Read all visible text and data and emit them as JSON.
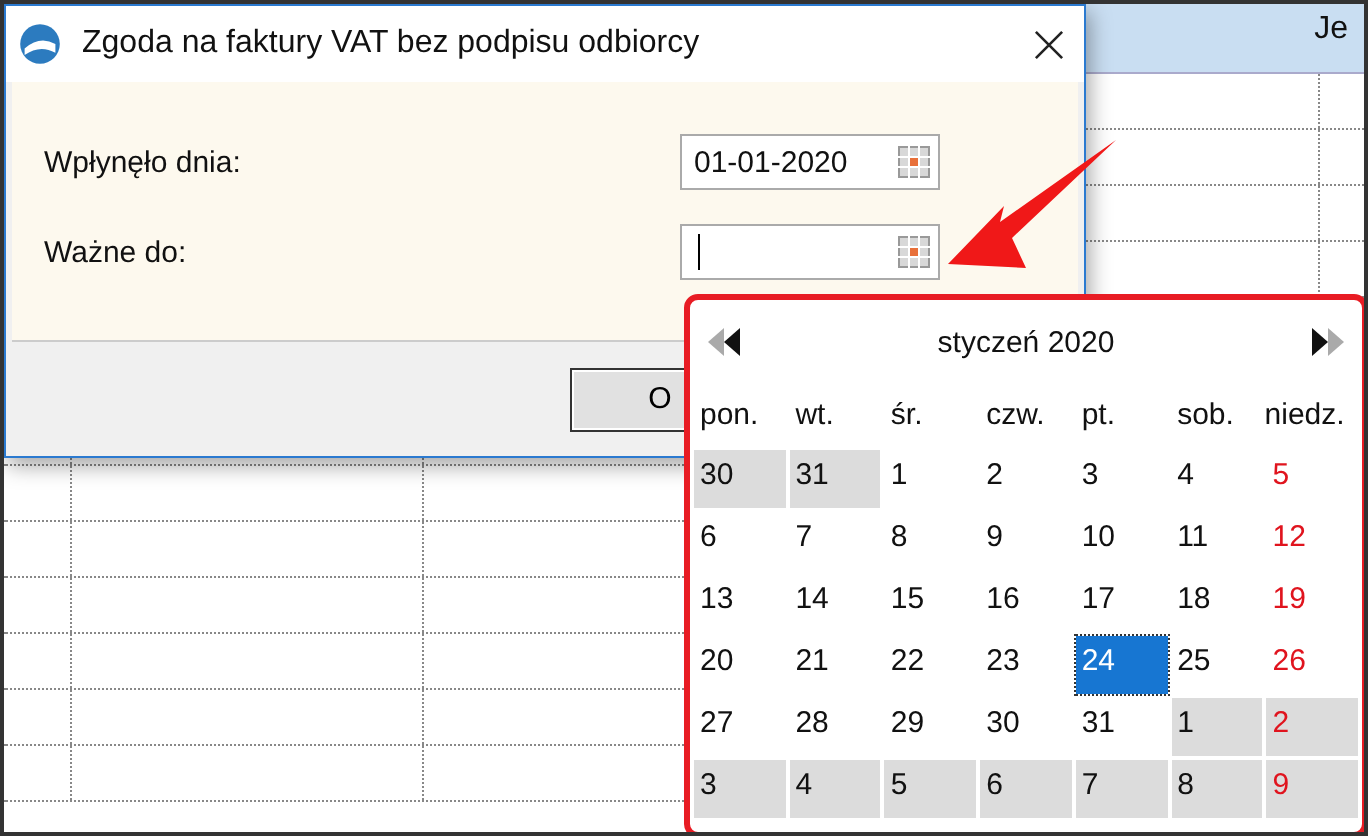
{
  "grid": {
    "header_text": "Je"
  },
  "window": {
    "title": "Zgoda na faktury VAT bez podpisu odbiorcy"
  },
  "fields": [
    {
      "label": "Wpłynęło dnia:",
      "value": "01-01-2020",
      "focused": false
    },
    {
      "label": "Ważne do:",
      "focused": true
    }
  ],
  "button": "O",
  "calendar": {
    "month": "styczeń 2020",
    "weekdays": [
      "pon.",
      "wt.",
      "śr.",
      "czw.",
      "pt.",
      "sob.",
      "niedz."
    ],
    "weeks": [
      [
        {
          "d": "30",
          "outside": true,
          "sunday": false,
          "selected": false
        },
        {
          "d": "31",
          "outside": true,
          "sunday": false,
          "selected": false
        },
        {
          "d": "1",
          "outside": false,
          "sunday": false,
          "selected": false
        },
        {
          "d": "2",
          "outside": false,
          "sunday": false,
          "selected": false
        },
        {
          "d": "3",
          "outside": false,
          "sunday": false,
          "selected": false
        },
        {
          "d": "4",
          "outside": false,
          "sunday": false,
          "selected": false
        },
        {
          "d": "5",
          "outside": false,
          "sunday": true,
          "selected": false
        }
      ],
      [
        {
          "d": "6",
          "outside": false,
          "sunday": false,
          "selected": false
        },
        {
          "d": "7",
          "outside": false,
          "sunday": false,
          "selected": false
        },
        {
          "d": "8",
          "outside": false,
          "sunday": false,
          "selected": false
        },
        {
          "d": "9",
          "outside": false,
          "sunday": false,
          "selected": false
        },
        {
          "d": "10",
          "outside": false,
          "sunday": false,
          "selected": false
        },
        {
          "d": "11",
          "outside": false,
          "sunday": false,
          "selected": false
        },
        {
          "d": "12",
          "outside": false,
          "sunday": true,
          "selected": false
        }
      ],
      [
        {
          "d": "13",
          "outside": false,
          "sunday": false,
          "selected": false
        },
        {
          "d": "14",
          "outside": false,
          "sunday": false,
          "selected": false
        },
        {
          "d": "15",
          "outside": false,
          "sunday": false,
          "selected": false
        },
        {
          "d": "16",
          "outside": false,
          "sunday": false,
          "selected": false
        },
        {
          "d": "17",
          "outside": false,
          "sunday": false,
          "selected": false
        },
        {
          "d": "18",
          "outside": false,
          "sunday": false,
          "selected": false
        },
        {
          "d": "19",
          "outside": false,
          "sunday": true,
          "selected": false
        }
      ],
      [
        {
          "d": "20",
          "outside": false,
          "sunday": false,
          "selected": false
        },
        {
          "d": "21",
          "outside": false,
          "sunday": false,
          "selected": false
        },
        {
          "d": "22",
          "outside": false,
          "sunday": false,
          "selected": false
        },
        {
          "d": "23",
          "outside": false,
          "sunday": false,
          "selected": false
        },
        {
          "d": "24",
          "outside": false,
          "sunday": false,
          "selected": true
        },
        {
          "d": "25",
          "outside": false,
          "sunday": false,
          "selected": false
        },
        {
          "d": "26",
          "outside": false,
          "sunday": true,
          "selected": false
        }
      ],
      [
        {
          "d": "27",
          "outside": false,
          "sunday": false,
          "selected": false
        },
        {
          "d": "28",
          "outside": false,
          "sunday": false,
          "selected": false
        },
        {
          "d": "29",
          "outside": false,
          "sunday": false,
          "selected": false
        },
        {
          "d": "30",
          "outside": false,
          "sunday": false,
          "selected": false
        },
        {
          "d": "31",
          "outside": false,
          "sunday": false,
          "selected": false
        },
        {
          "d": "1",
          "outside": true,
          "sunday": false,
          "selected": false
        },
        {
          "d": "2",
          "outside": true,
          "sunday": true,
          "selected": false
        }
      ],
      [
        {
          "d": "3",
          "outside": true,
          "sunday": false,
          "selected": false
        },
        {
          "d": "4",
          "outside": true,
          "sunday": false,
          "selected": false
        },
        {
          "d": "5",
          "outside": true,
          "sunday": false,
          "selected": false
        },
        {
          "d": "6",
          "outside": true,
          "sunday": false,
          "selected": false
        },
        {
          "d": "7",
          "outside": true,
          "sunday": false,
          "selected": false
        },
        {
          "d": "8",
          "outside": true,
          "sunday": false,
          "selected": false
        },
        {
          "d": "9",
          "outside": true,
          "sunday": true,
          "selected": false
        }
      ]
    ]
  }
}
